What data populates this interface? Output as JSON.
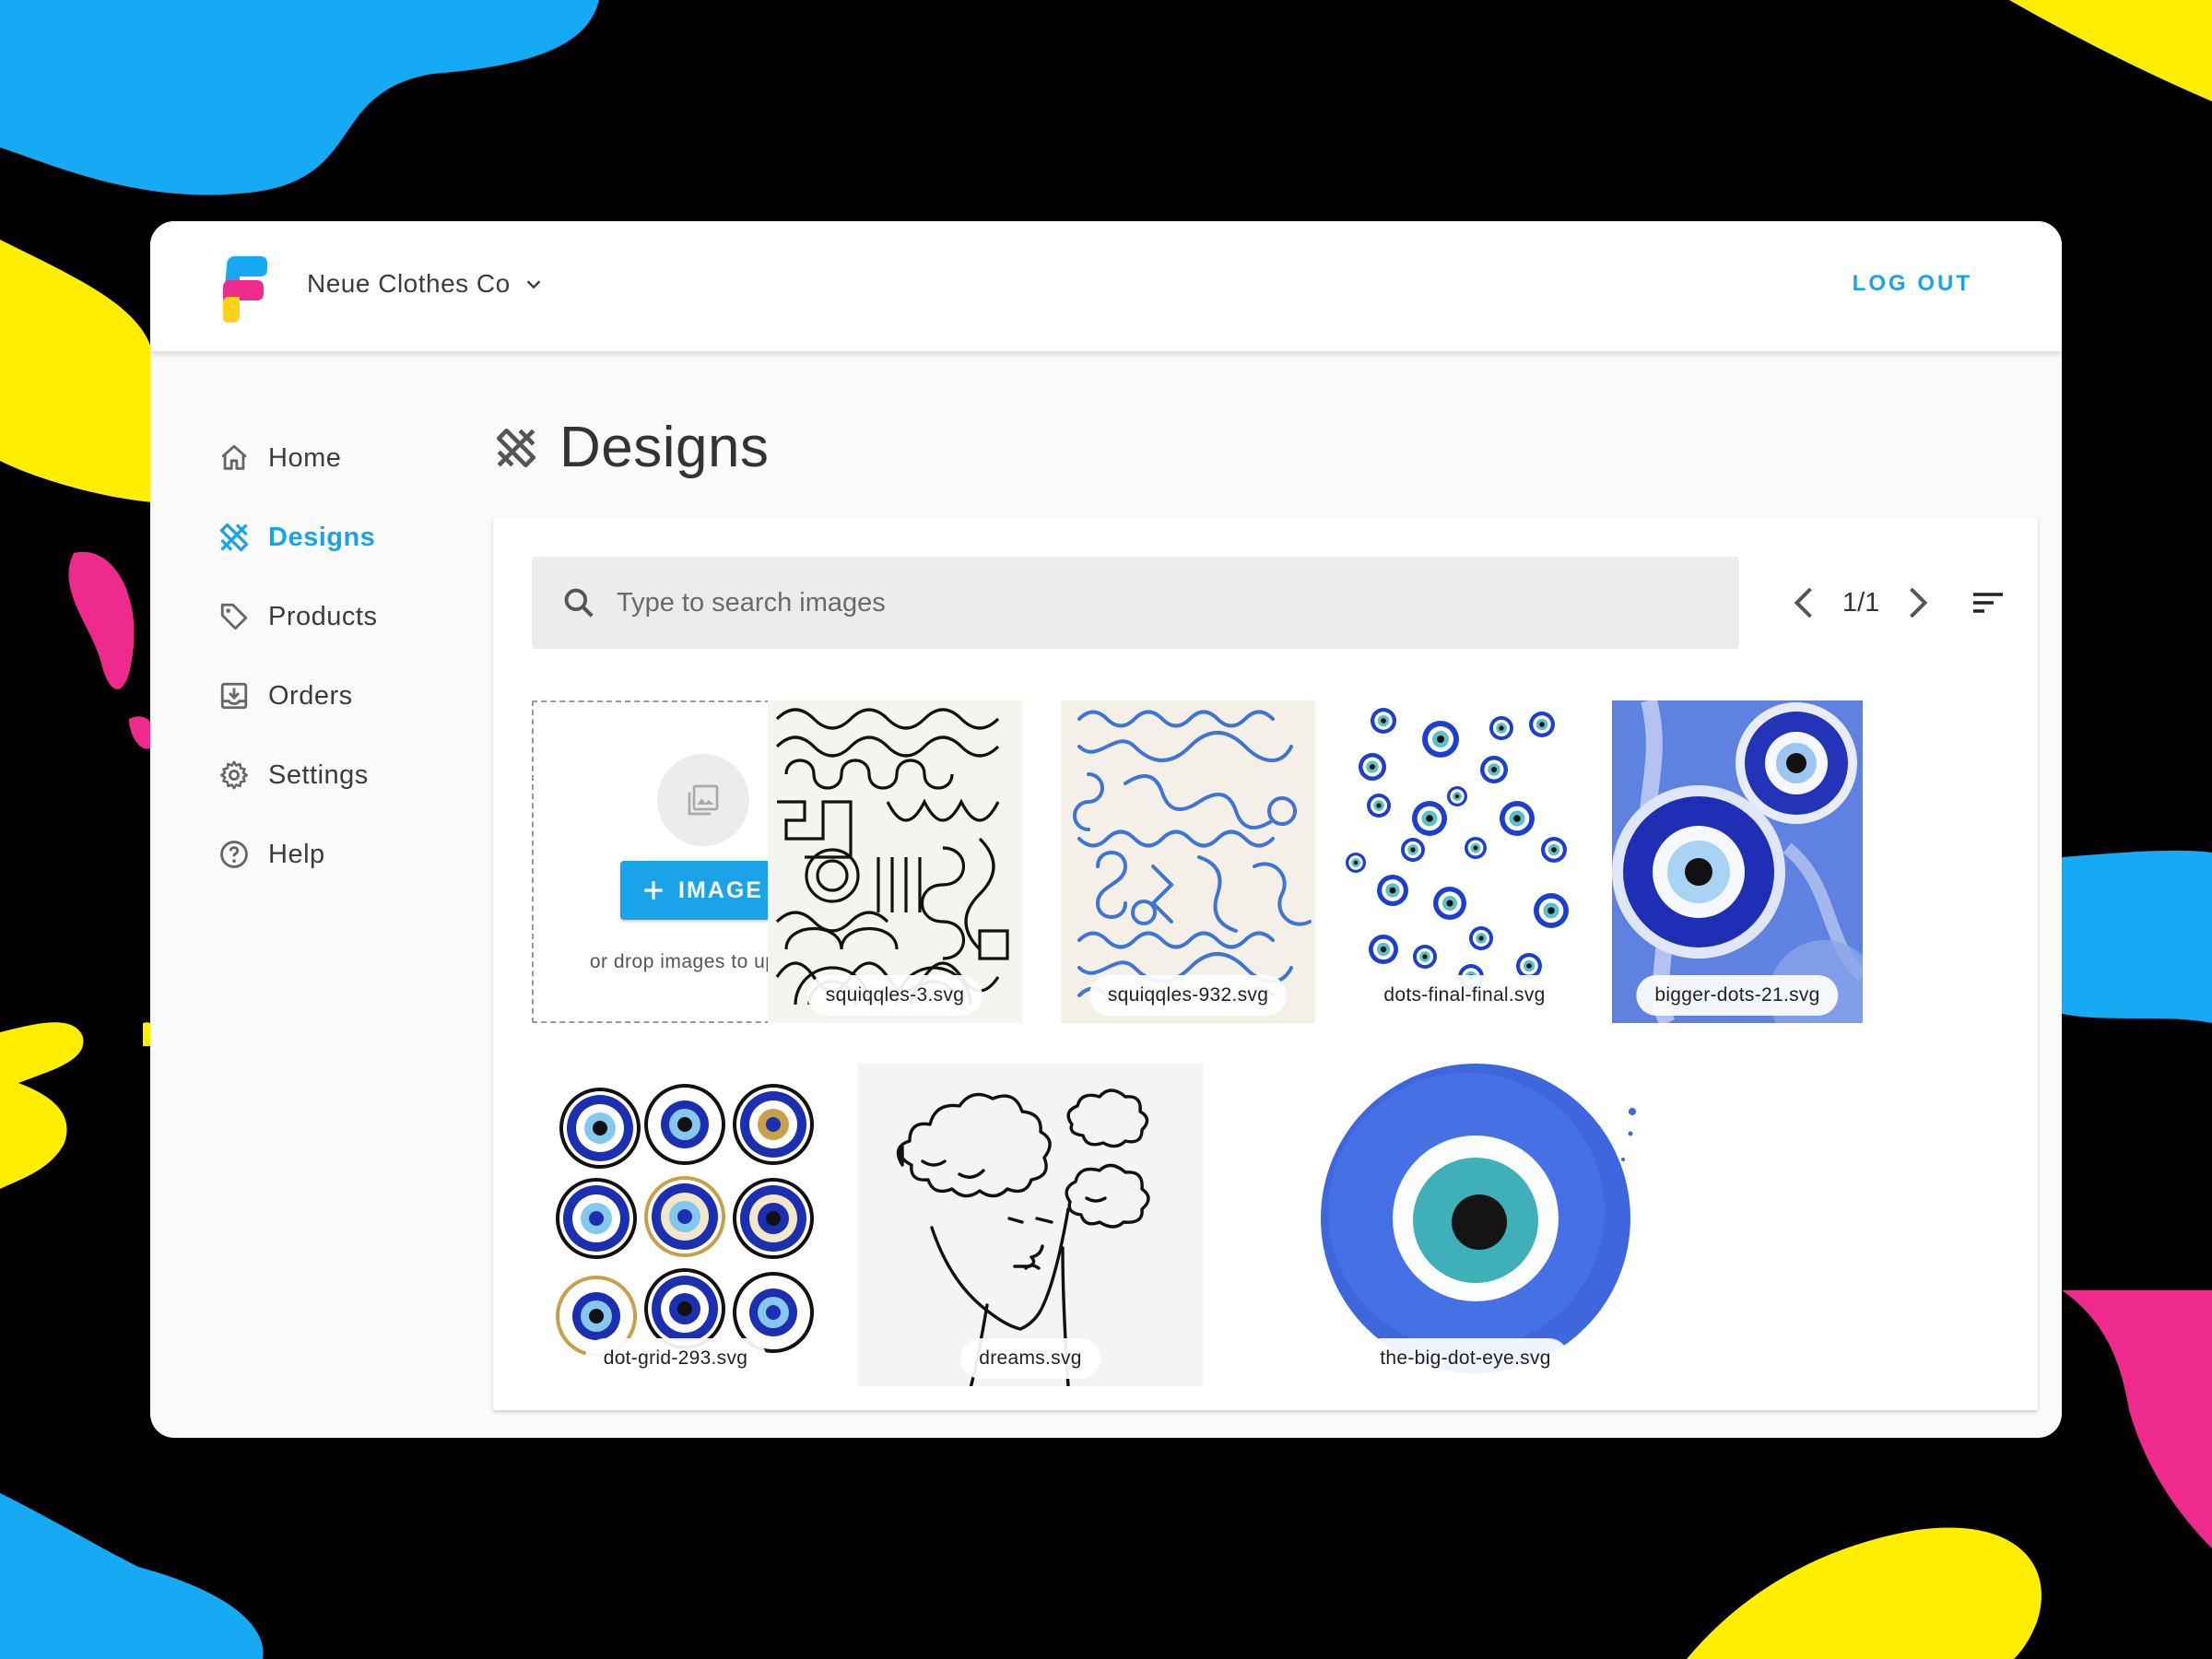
{
  "header": {
    "org_name": "Neue Clothes Co",
    "logout_label": "LOG OUT"
  },
  "sidebar": {
    "items": [
      {
        "label": "Home",
        "icon": "home-icon",
        "active": false
      },
      {
        "label": "Designs",
        "icon": "designs-icon",
        "active": true
      },
      {
        "label": "Products",
        "icon": "tag-icon",
        "active": false
      },
      {
        "label": "Orders",
        "icon": "inbox-download-icon",
        "active": false
      },
      {
        "label": "Settings",
        "icon": "gear-icon",
        "active": false
      },
      {
        "label": "Help",
        "icon": "help-circle-icon",
        "active": false
      }
    ]
  },
  "page": {
    "title": "Designs"
  },
  "search": {
    "placeholder": "Type to search images",
    "value": ""
  },
  "pager": {
    "page": "1/1"
  },
  "upload": {
    "button_label": "IMAGE",
    "hint": "or drop images to upload"
  },
  "images": [
    {
      "name": "squiqqles-3.svg"
    },
    {
      "name": "squiqqles-932.svg"
    },
    {
      "name": "dots-final-final.svg"
    },
    {
      "name": "bigger-dots-21.svg"
    },
    {
      "name": "dot-grid-293.svg"
    },
    {
      "name": "dreams.svg"
    },
    {
      "name": "the-big-dot-eye.svg"
    }
  ],
  "colors": {
    "accent": "#1aa3e8",
    "background": "#000000",
    "blob_blue": "#16a9f4",
    "blob_yellow": "#ffee00",
    "blob_pink": "#ee2a8c",
    "panel": "#fafaf9"
  }
}
